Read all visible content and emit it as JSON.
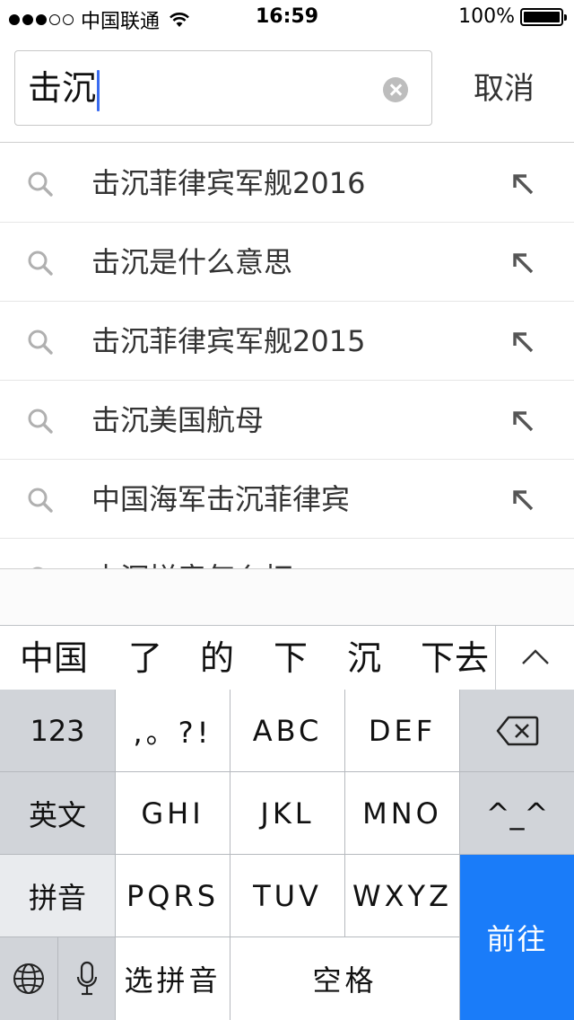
{
  "status_bar": {
    "carrier": "中国联通",
    "time": "16:59",
    "battery": "100%",
    "battery_level": 1.0,
    "signal_bars_filled": 3,
    "signal_bars_total": 5
  },
  "search": {
    "query": "击沉",
    "cancel_label": "取消"
  },
  "suggestions": [
    {
      "label": "击沉菲律宾军舰2016"
    },
    {
      "label": "击沉是什么意思"
    },
    {
      "label": "击沉菲律宾军舰2015"
    },
    {
      "label": "击沉美国航母"
    },
    {
      "label": "中国海军击沉菲律宾"
    },
    {
      "label": "击沉拼音怎么打"
    }
  ],
  "candidates": [
    "中国",
    "了",
    "的",
    "下",
    "沉",
    "下去"
  ],
  "keyboard": {
    "numbers": "123",
    "punct": ",。?!",
    "abc": "ABC",
    "def": "DEF",
    "english": "英文",
    "ghi": "GHI",
    "jkl": "JKL",
    "mno": "MNO",
    "emoticon": "^_^",
    "pinyin": "拼音",
    "pqrs": "PQRS",
    "tuv": "TUV",
    "wxyz": "WXYZ",
    "select_pinyin": "选拼音",
    "space": "空格",
    "go": "前往"
  },
  "colors": {
    "go_key": "#1a7cf9",
    "caret": "#3a6cf0",
    "func_key": "#d1d4d9"
  }
}
